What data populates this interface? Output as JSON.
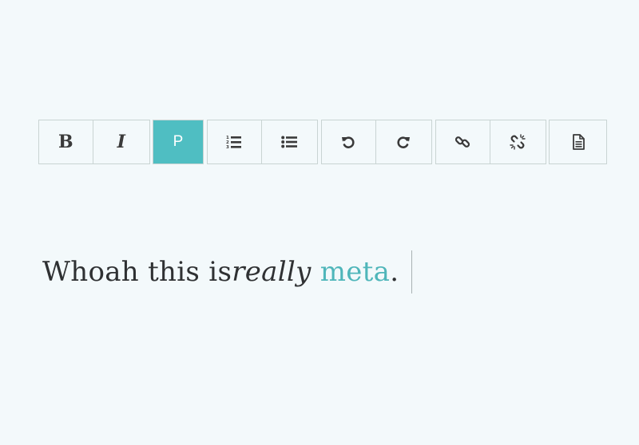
{
  "toolbar": {
    "bold_label": "B",
    "italic_label": "I",
    "paragraph_label": "P",
    "icons": {
      "ordered_list": "ordered-list-icon",
      "unordered_list": "unordered-list-icon",
      "undo": "undo-icon",
      "redo": "redo-icon",
      "link": "link-icon",
      "unlink": "unlink-icon",
      "source": "document-icon"
    },
    "active_button": "P",
    "accent_color": "#4fbec2"
  },
  "editor": {
    "text_before": "Whoah this is ",
    "text_italic": "really",
    "text_space": " ",
    "text_link": "meta",
    "text_after": ".",
    "link_color": "#4fb6ba"
  }
}
